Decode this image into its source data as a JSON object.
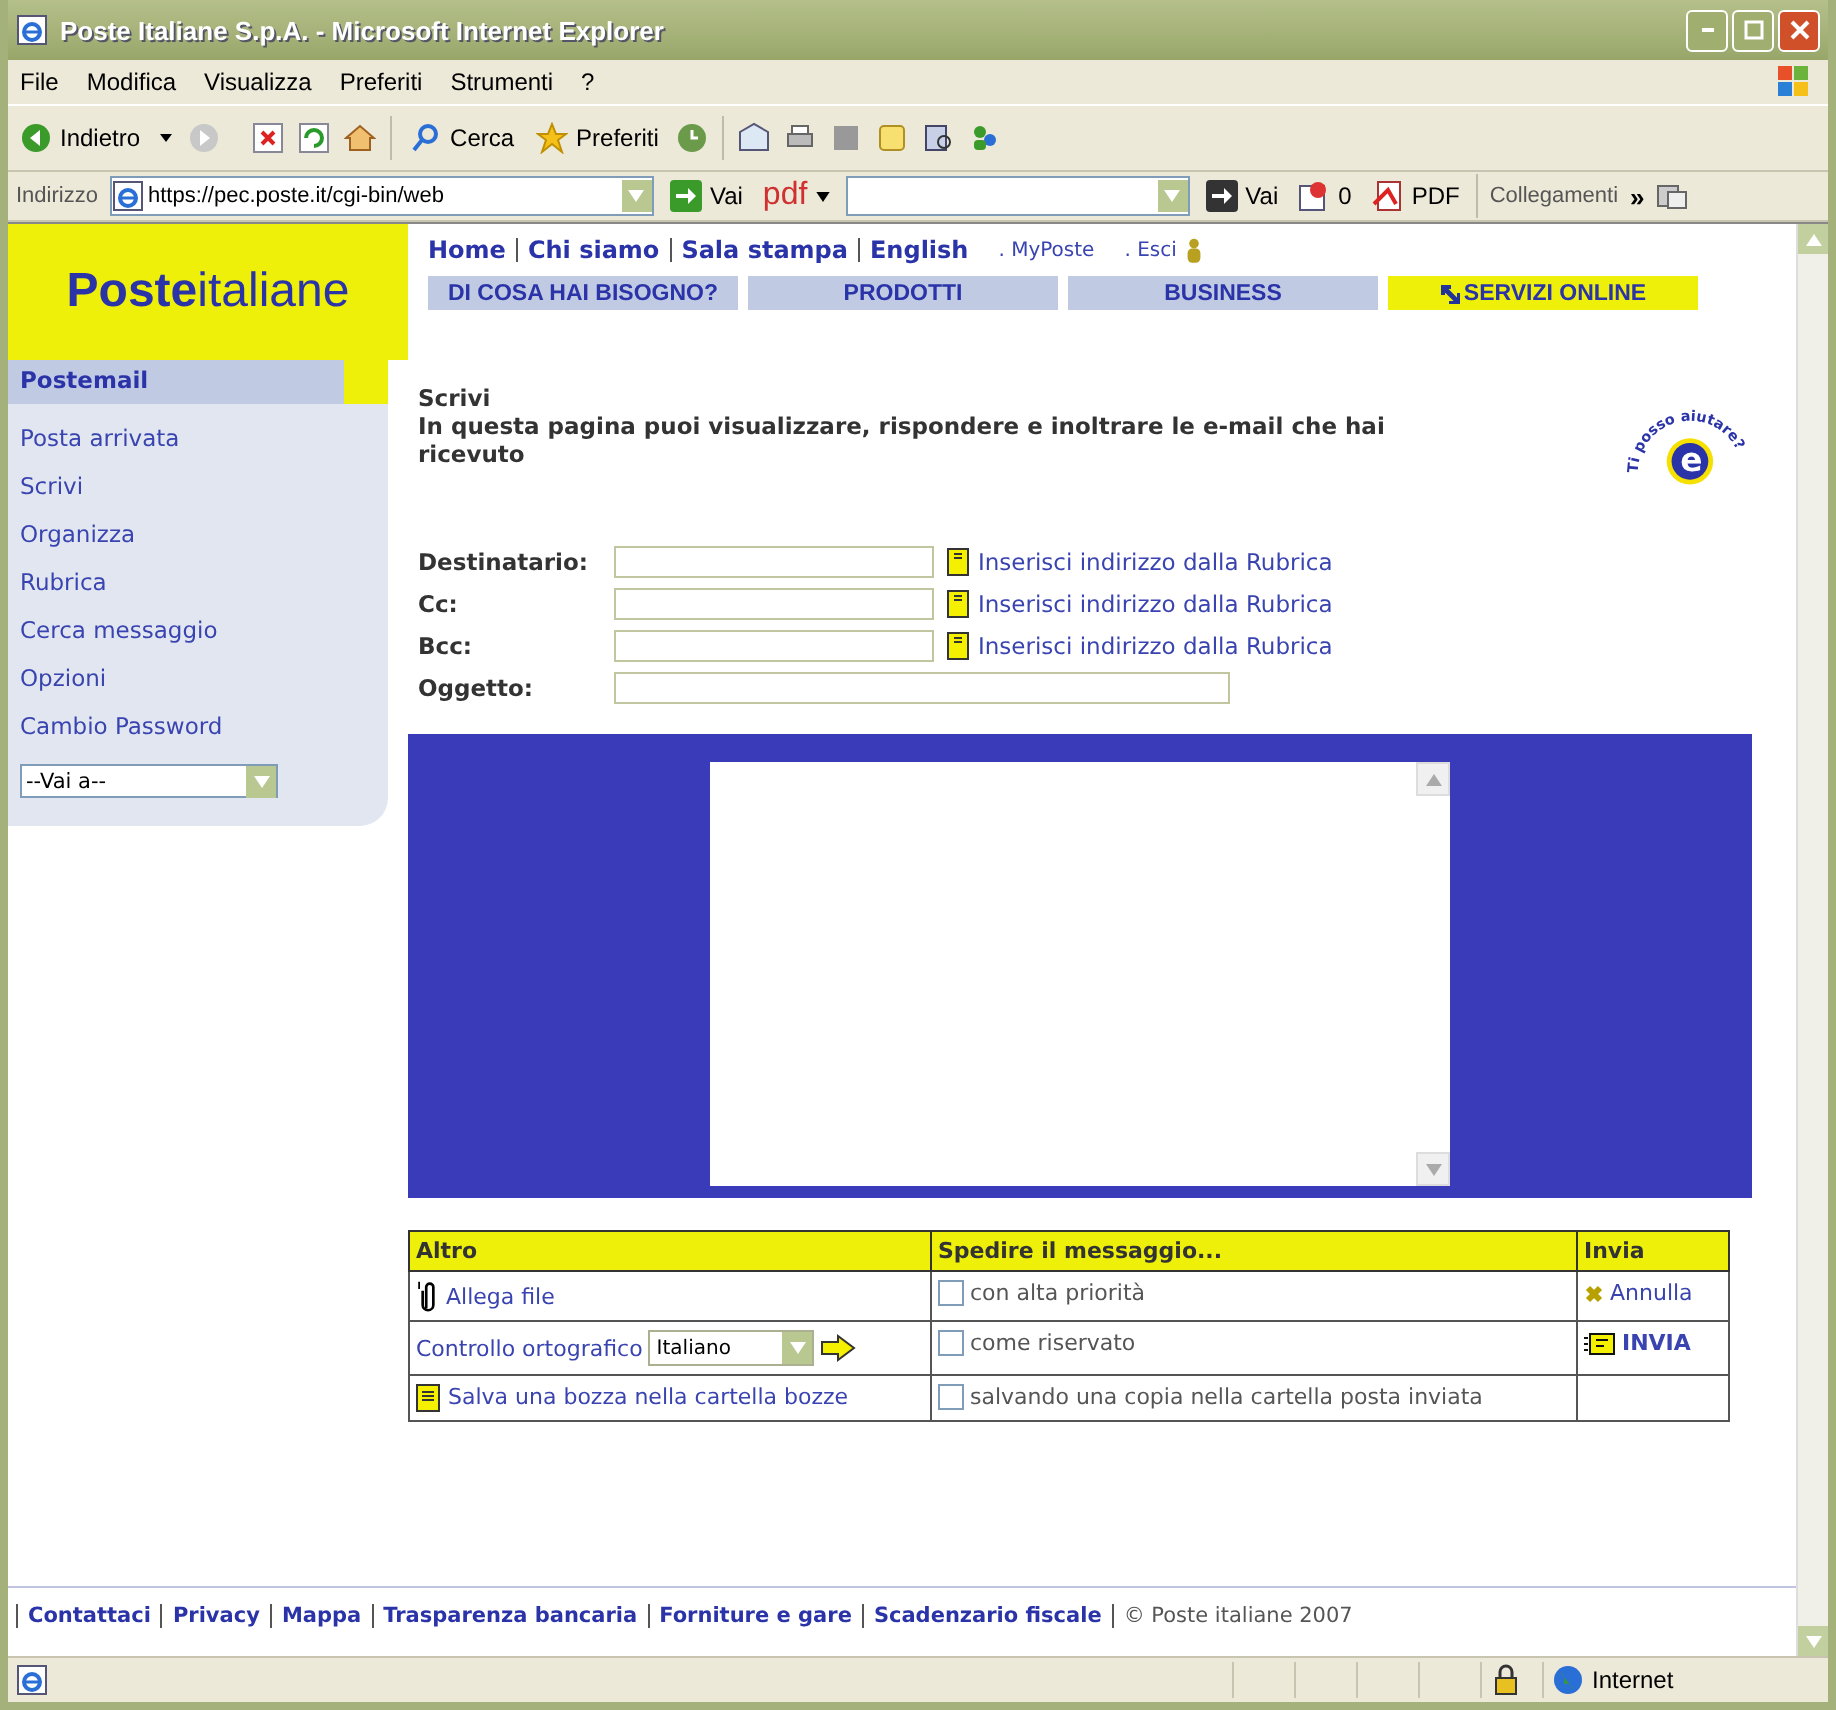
{
  "window": {
    "title": "Poste Italiane S.p.A. - Microsoft Internet Explorer"
  },
  "menu": [
    "File",
    "Modifica",
    "Visualizza",
    "Preferiti",
    "Strumenti",
    "?"
  ],
  "toolbar": {
    "back": "Indietro",
    "search": "Cerca",
    "favorites": "Preferiti"
  },
  "address_bar": {
    "label": "Indirizzo",
    "url": "https://pec.poste.it/cgi-bin/web",
    "go": "Vai",
    "pdf": "pdf",
    "go2": "Vai",
    "count": "0",
    "pdf_button": "PDF",
    "links": "Collegamenti",
    "more": "»"
  },
  "page": {
    "logo": "**Poste**italiane",
    "top_links": [
      "Home",
      "Chi siamo",
      "Sala stampa",
      "English"
    ],
    "user_links": [
      ". MyPoste",
      ". Esci"
    ],
    "nav": [
      {
        "label": "DI COSA HAI BISOGNO?",
        "selected": false
      },
      {
        "label": "PRODOTTI",
        "selected": false
      },
      {
        "label": "BUSINESS",
        "selected": false
      },
      {
        "label": "SERVIZI ONLINE",
        "selected": true
      }
    ],
    "sidebar": {
      "title": "Postemail",
      "items": [
        "Posta arrivata",
        "Scrivi",
        "Organizza",
        "Rubrica",
        "Cerca messaggio",
        "Opzioni",
        "Cambio Password"
      ],
      "select": "--Vai a--"
    },
    "heading": "Scrivi",
    "description": "In questa pagina puoi visualizzare, rispondere e inoltrare le e-mail che hai ricevuto",
    "help": {
      "text": "Ti posso aiutare?",
      "letter": "e"
    },
    "fields": [
      {
        "label": "Destinatario:",
        "link": "Inserisci indirizzo dalla Rubrica"
      },
      {
        "label": "Cc:",
        "link": "Inserisci indirizzo dalla Rubrica"
      },
      {
        "label": "Bcc:",
        "link": "Inserisci indirizzo dalla Rubrica"
      },
      {
        "label": "Oggetto:"
      }
    ],
    "options": {
      "columns": [
        "Altro",
        "Spedire il messaggio...",
        "Invia"
      ],
      "rows": [
        {
          "action": "Allega file",
          "kind": "attach",
          "option": "con alta priorità",
          "checked": false,
          "send": "Annulla"
        },
        {
          "action": "Controllo ortografico",
          "kind": "spell",
          "language": "Italiano",
          "option": "come riservato",
          "checked": false,
          "send": "INVIA"
        },
        {
          "action": "Salva una bozza nella cartella bozze",
          "kind": "draft",
          "option": "salvando una copia nella cartella posta inviata",
          "checked": false
        }
      ]
    },
    "footer_links": [
      "Contattaci",
      "Privacy",
      "Mappa",
      "Trasparenza bancaria",
      "Forniture e gare",
      "Scadenzario fiscale"
    ],
    "copyright": "© Poste italiane 2007"
  },
  "status_bar": {
    "zone": "Internet"
  }
}
